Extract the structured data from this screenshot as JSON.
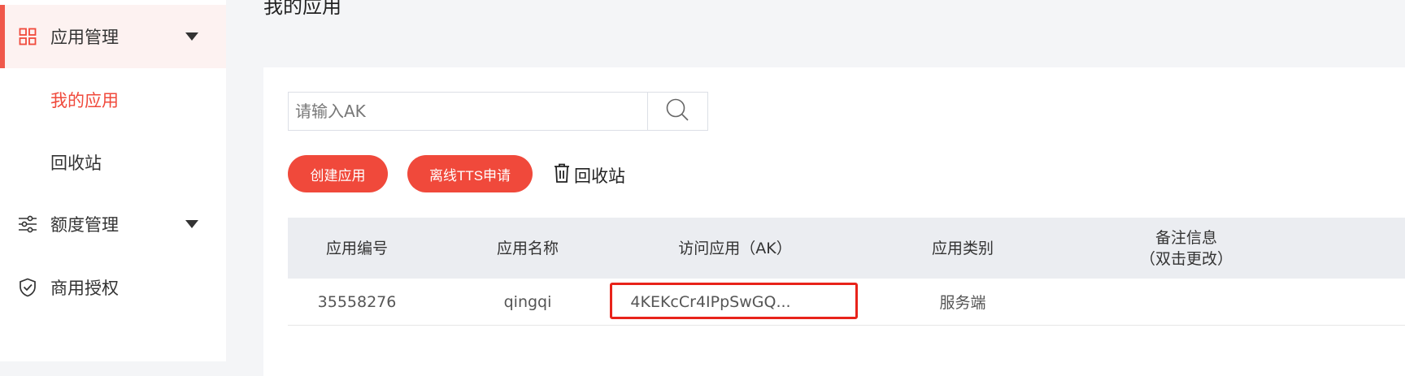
{
  "sidebar": {
    "app_mgmt": "应用管理",
    "my_apps": "我的应用",
    "recycle_bin": "回收站",
    "quota_mgmt": "额度管理",
    "commercial_auth": "商用授权"
  },
  "main": {
    "title": "我的应用",
    "search": {
      "placeholder": "请输入AK",
      "value": ""
    },
    "buttons": {
      "create": "创建应用",
      "offline_tts": "离线TTS申请",
      "recycle": "回收站"
    },
    "table": {
      "headers": [
        "应用编号",
        "应用名称",
        "访问应用（AK）",
        "应用类别",
        "备注信息",
        "（双击更改）"
      ],
      "rows": [
        {
          "id": "35558276",
          "name": "qingqi",
          "ak": "4KEKcCr4IPpSwGQ...",
          "category": "服务端",
          "remark": ""
        }
      ]
    }
  },
  "colors": {
    "accent": "#f0493b",
    "active_bg": "#fdf2f1",
    "header_bg": "#ebedf1"
  },
  "icons": [
    "grid-icon",
    "sliders-icon",
    "shield-check-icon",
    "search-icon",
    "trash-icon",
    "caret-down-icon"
  ]
}
